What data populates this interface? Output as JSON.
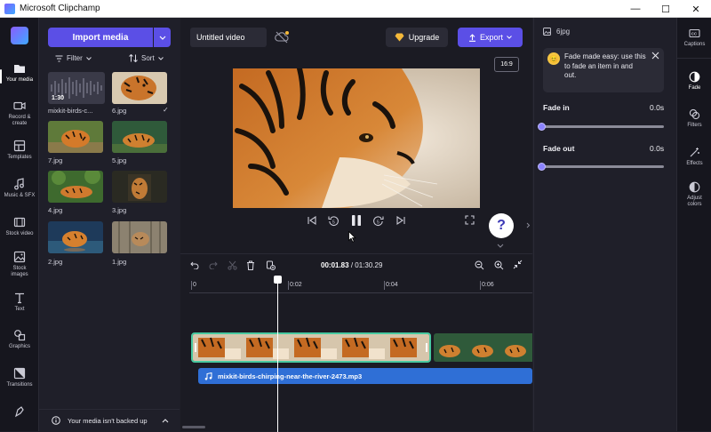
{
  "window": {
    "title": "Microsoft Clipchamp",
    "minimize": "—",
    "maximize": "☐",
    "close": "✕"
  },
  "nav": [
    {
      "label": "Your media",
      "icon": "folder-icon"
    },
    {
      "label": "Record & create",
      "icon": "camera-icon"
    },
    {
      "label": "Templates",
      "icon": "templates-icon"
    },
    {
      "label": "Music & SFX",
      "icon": "music-icon"
    },
    {
      "label": "Stock video",
      "icon": "film-icon"
    },
    {
      "label": "Stock images",
      "icon": "image-icon"
    },
    {
      "label": "Text",
      "icon": "text-icon"
    },
    {
      "label": "Graphics",
      "icon": "shapes-icon"
    },
    {
      "label": "Transitions",
      "icon": "transition-icon"
    }
  ],
  "media": {
    "import_label": "Import media",
    "filter_label": "Filter",
    "sort_label": "Sort",
    "items": [
      {
        "label": "mixkit-birds-c...",
        "duration": "1:30",
        "checked": false
      },
      {
        "label": "6.jpg",
        "checked": true
      },
      {
        "label": "7.jpg",
        "checked": false
      },
      {
        "label": "5.jpg",
        "checked": false
      },
      {
        "label": "4.jpg",
        "checked": false
      },
      {
        "label": "3.jpg",
        "checked": false
      },
      {
        "label": "2.jpg",
        "checked": false
      },
      {
        "label": "1.jpg",
        "checked": false
      }
    ],
    "backup_text": "Your media isn't backed up"
  },
  "preview": {
    "project_title": "Untitled video",
    "upgrade_label": "Upgrade",
    "export_label": "Export",
    "aspect_ratio": "16:9",
    "help_label": "?"
  },
  "properties": {
    "file_name": "6jpg",
    "tip_text": "Fade made easy: use this to fade an item in and out.",
    "fade_in_label": "Fade in",
    "fade_in_value": "0.0s",
    "fade_out_label": "Fade out",
    "fade_out_value": "0.0s"
  },
  "right_rail": [
    {
      "label": "Captions",
      "icon": "captions-icon"
    },
    {
      "label": "Fade",
      "icon": "fade-icon"
    },
    {
      "label": "Filters",
      "icon": "filters-icon"
    },
    {
      "label": "Effects",
      "icon": "effects-icon"
    },
    {
      "label": "Adjust colors",
      "icon": "adjust-colors-icon"
    }
  ],
  "timeline": {
    "current_time": "00:01.83",
    "separator": " / ",
    "total_time": "01:30.29",
    "ticks": [
      "0",
      "0:02",
      "0:04",
      "0:06"
    ],
    "audio_clip_name": "mixkit-birds-chirping-near-the-river-2473.mp3"
  },
  "colors": {
    "accent": "#5b4fe6",
    "clip_border": "#48c9a0",
    "audio": "#2f6fd6"
  }
}
